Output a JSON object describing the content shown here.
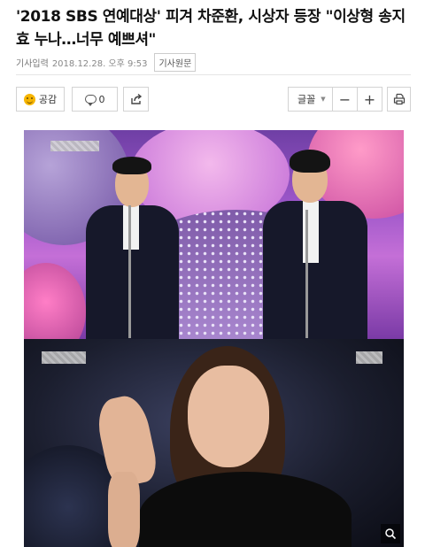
{
  "article": {
    "headline": "'2018 SBS 연예대상' 피겨 차준환, 시상자 등장 \"이상형 송지효 누나…너무 예쁘셔\"",
    "meta_label": "기사입력",
    "date": "2018.12.28. 오후 9:53",
    "original_button": "기사원문"
  },
  "toolbar": {
    "like_label": "공감",
    "comment_count": "0",
    "font_label": "글꼴",
    "minus_label": "−",
    "plus_label": "+"
  },
  "colors": {
    "like_icon": "#f6b500",
    "border": "#d3d3d3",
    "text": "#111111"
  },
  "icons": {
    "like": "smile-icon",
    "comment": "speech-bubble-icon",
    "share": "share-arrow-icon",
    "font_dropdown": "chevron-down-icon",
    "print": "printer-icon",
    "zoom": "magnifier-zoom-icon"
  }
}
